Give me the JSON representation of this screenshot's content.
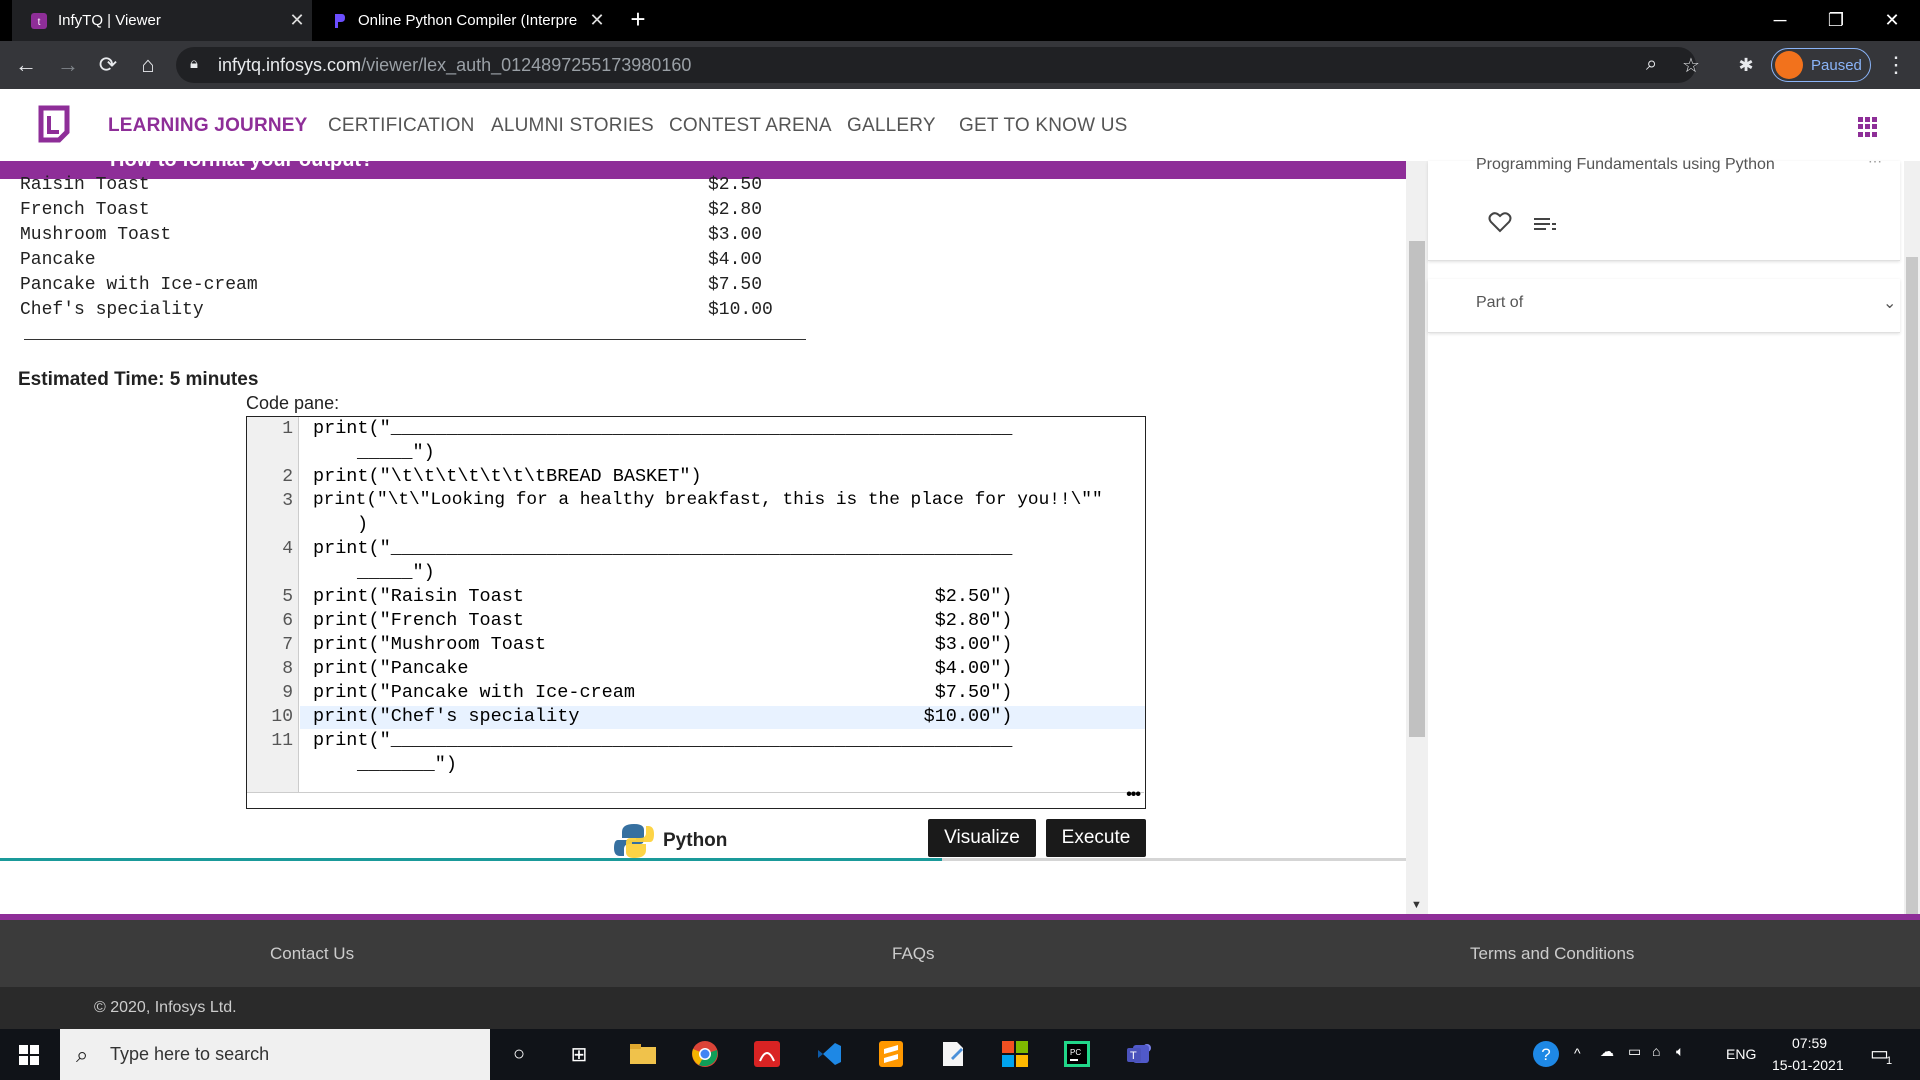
{
  "browser": {
    "tabs": [
      {
        "title": "InfyTQ | Viewer",
        "active": true
      },
      {
        "title": "Online Python Compiler (Interpre",
        "active": false
      }
    ],
    "url_domain": "infytq.infosys.com",
    "url_path": "/viewer/lex_auth_0124897255173980160",
    "profile_status": "Paused"
  },
  "site": {
    "nav": [
      {
        "label": "LEARNING JOURNEY",
        "active": true
      },
      {
        "label": "CERTIFICATION"
      },
      {
        "label": "ALUMNI STORIES"
      },
      {
        "label": "CONTEST ARENA"
      },
      {
        "label": "GALLERY"
      },
      {
        "label": "GET TO KNOW US"
      }
    ]
  },
  "viewer": {
    "header_title": "How to format your output?",
    "menu_output": [
      {
        "item": "Raisin Toast",
        "price": "$2.50"
      },
      {
        "item": "French Toast",
        "price": "$2.80"
      },
      {
        "item": "Mushroom Toast",
        "price": "$3.00"
      },
      {
        "item": "Pancake",
        "price": "$4.00"
      },
      {
        "item": "Pancake with Ice-cream",
        "price": "$7.50"
      },
      {
        "item": "Chef's speciality",
        "price": "$10.00"
      }
    ],
    "estimated_time": "Estimated Time: 5 minutes",
    "code_pane_label": "Code pane:",
    "code_lines": [
      {
        "n": "1",
        "text": "print(\"________________________________________________________",
        "cont": "_____\")"
      },
      {
        "n": "2",
        "text": "print(\"\\t\\t\\t\\t\\t\\t\\tBREAD BASKET\")"
      },
      {
        "n": "3",
        "text": "print(\"\\t\\\"Looking for a healthy breakfast, this is the place for you!!\\\"\"",
        "cont": ")"
      },
      {
        "n": "4",
        "text": "print(\"________________________________________________________",
        "cont": "_____\")"
      },
      {
        "n": "5",
        "text": "print(\"Raisin Toast                                     $2.50\")"
      },
      {
        "n": "6",
        "text": "print(\"French Toast                                     $2.80\")"
      },
      {
        "n": "7",
        "text": "print(\"Mushroom Toast                                   $3.00\")"
      },
      {
        "n": "8",
        "text": "print(\"Pancake                                          $4.00\")"
      },
      {
        "n": "9",
        "text": "print(\"Pancake with Ice-cream                           $7.50\")"
      },
      {
        "n": "10",
        "text": "print(\"Chef's speciality                               $10.00\")"
      },
      {
        "n": "11",
        "text": "print(\"________________________________________________________",
        "cont": "_______\")"
      }
    ],
    "language": "Python",
    "visualize_label": "Visualize",
    "execute_label": "Execute",
    "progress_fraction": 0.67
  },
  "sidebar": {
    "course_name": "Programming Fundamentals using Python",
    "part_of_label": "Part of"
  },
  "footer": {
    "contact": "Contact Us",
    "faqs": "FAQs",
    "terms": "Terms and Conditions",
    "copyright": "© 2020, Infosys Ltd."
  },
  "taskbar": {
    "search_placeholder": "Type here to search",
    "language": "ENG",
    "time": "07:59",
    "date": "15-01-2021",
    "notifications": "1"
  },
  "colors": {
    "brand_purple": "#8e2e98",
    "teal": "#1a9a9a"
  }
}
